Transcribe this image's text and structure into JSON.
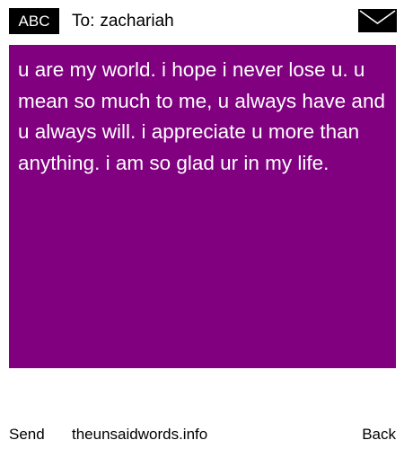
{
  "header": {
    "badge_label": "ABC",
    "to_prefix": "To:",
    "recipient": "zachariah",
    "envelope_icon": "envelope-icon"
  },
  "message": {
    "text": "u are my world. i hope i never lose u. u mean so much to me, u always have and u always will. i appreciate u more than anything. i am so glad ur in my life.",
    "background_color": "#800080",
    "text_color": "#ffffff"
  },
  "footer": {
    "send_label": "Send",
    "site_label": "theunsaidwords.info",
    "back_label": "Back"
  }
}
